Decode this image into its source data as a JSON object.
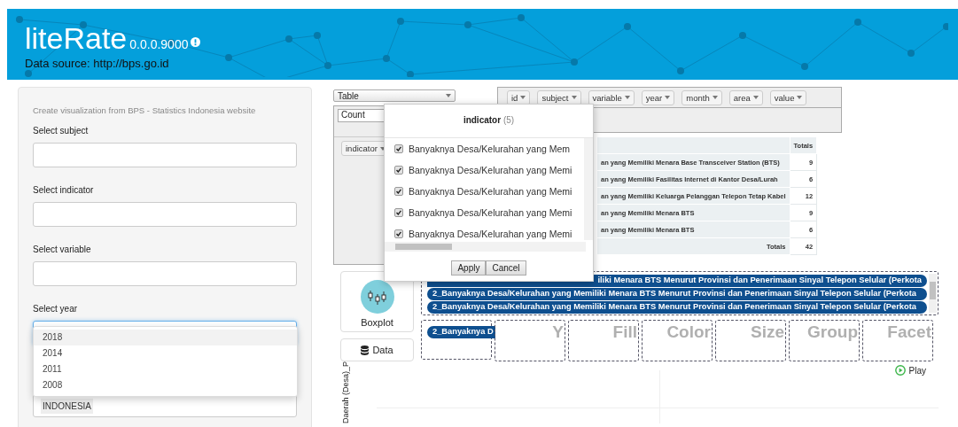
{
  "header": {
    "title": "liteRate",
    "version": "0.0.0.9000",
    "source": "Data source: http://bps.go.id"
  },
  "sidebar": {
    "intro": "Create visualization from BPS - Statistics Indonesia website",
    "fields": [
      {
        "label": "Select subject",
        "focused": false
      },
      {
        "label": "Select indicator",
        "focused": false
      },
      {
        "label": "Select variable",
        "focused": false
      },
      {
        "label": "Select year",
        "focused": true
      }
    ],
    "year_options": [
      {
        "label": "2018",
        "selected": true
      },
      {
        "label": "2014",
        "selected": false
      },
      {
        "label": "2011",
        "selected": false
      },
      {
        "label": "2008",
        "selected": false
      }
    ],
    "area_tags": [
      "INDONESIA"
    ]
  },
  "pivot": {
    "renderer": "Table",
    "aggregator": "Count",
    "row_attributes": [
      "indicator"
    ],
    "attributes": [
      "id",
      "subject",
      "variable",
      "year",
      "month",
      "area",
      "value"
    ],
    "table": {
      "totals_header": "Totals",
      "rows": [
        {
          "label": "an yang Memiliki Menara Base Transceiver Station (BTS)",
          "total": "9"
        },
        {
          "label": "an yang Memiliki Fasilitas Internet di Kantor Desa/Lurah",
          "total": "6"
        },
        {
          "label": "an yang Memiliki Keluarga Pelanggan Telepon Tetap Kabel",
          "total": "12"
        },
        {
          "label": "an yang Memiliki Menara BTS",
          "total": "9"
        },
        {
          "label": "an yang Memiliki Menara BTS",
          "total": "6"
        }
      ],
      "totals_label": "Totals",
      "grand_total": "42"
    }
  },
  "filter_popup": {
    "title": "indicator",
    "count": "(5)",
    "items": [
      {
        "label": "Banyaknya Desa/Kelurahan yang Mem",
        "checked": true
      },
      {
        "label": "Banyaknya Desa/Kelurahan yang Memi",
        "checked": true
      },
      {
        "label": "Banyaknya Desa/Kelurahan yang Memi",
        "checked": true
      },
      {
        "label": "Banyaknya Desa/Kelurahan yang Memi",
        "checked": true
      },
      {
        "label": "Banyaknya Desa/Kelurahan yang Memi",
        "checked": true
      }
    ],
    "buttons": [
      "Apply",
      "Cancel"
    ]
  },
  "chart_builder": {
    "chart_type": "Boxplot",
    "data_button": "Data",
    "variables": [
      {
        "label": "iliki Menara BTS Menurut Provinsi dan Penerimaan Sinyal Telepon Selular (Perkota",
        "kind": "partial"
      },
      {
        "label": "2_Banyaknya Desa/Kelurahan yang Memiliki Menara BTS Menurut Provinsi dan Penerimaan Sinyal Telepon Selular (Perkota",
        "kind": "full"
      },
      {
        "label": "2_Banyaknya Desa/Kelurahan yang Memiliki Menara BTS Menurut Provinsi dan Penerimaan Sinyal Telepon Selular (Perkota",
        "kind": "full"
      }
    ],
    "x_variable": "2_Banyaknya D",
    "zones": [
      "Y",
      "Fill",
      "Color",
      "Size",
      "Group",
      "Facet"
    ],
    "play": "Play",
    "y_axis_label": "Daerah (Desa)_P"
  }
}
